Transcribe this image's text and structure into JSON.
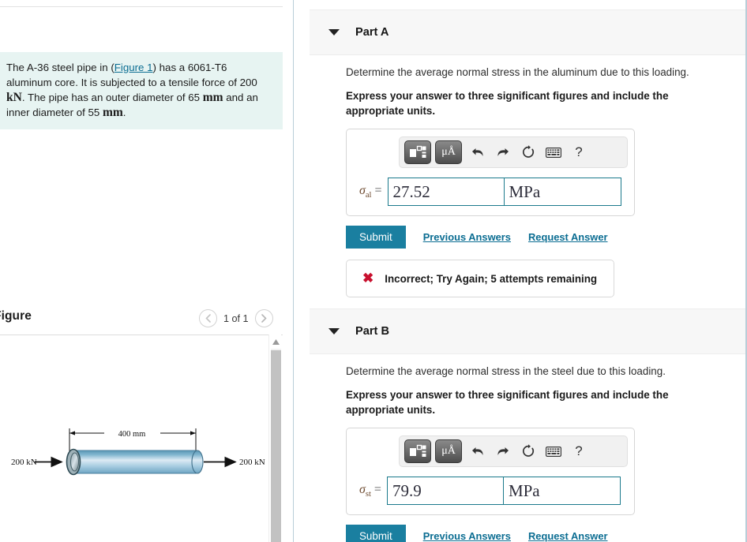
{
  "problem": {
    "text_before_link": "The A-36 steel pipe in (",
    "figure_link": "Figure 1",
    "text_after_link": ") has a 6061-T6 aluminum core. It is subjected to a tensile force of 200 ",
    "unit_force": "kN",
    "text_2": ". The pipe has an outer diameter of 65 ",
    "unit_mm_1": "mm",
    "text_3": " and an inner diameter of 55 ",
    "unit_mm_2": "mm",
    "text_4": "."
  },
  "figure": {
    "title": "Figure",
    "prev_icon": "chevron-left-icon",
    "next_icon": "chevron-right-icon",
    "counter": "1 of 1",
    "scroll_up_icon": "scroll-up-arrow-icon",
    "diagram": {
      "dimension_label": "400 mm",
      "force_left": "200 kN",
      "force_right": "200 kN"
    }
  },
  "parts": [
    {
      "caret_icon": "caret-down-icon",
      "title": "Part A",
      "prompt": "Determine the average normal stress in the aluminum due to this loading.",
      "instruction": "Express your answer to three significant figures and include the appropriate units.",
      "toolbar": {
        "template_icon": "math-template-icon",
        "units_label": "μÅ",
        "undo_icon": "undo-icon",
        "redo_icon": "redo-icon",
        "reset_icon": "reset-icon",
        "keyboard_icon": "keyboard-icon",
        "help_label": "?"
      },
      "symbol": "σ",
      "subscript": "al",
      "equals": "=",
      "value": "27.52",
      "unit": "MPa",
      "submit_label": "Submit",
      "previous_answers_label": "Previous Answers",
      "request_answer_label": "Request Answer",
      "feedback": {
        "icon": "incorrect-x-icon",
        "text": "Incorrect; Try Again; 5 attempts remaining"
      }
    },
    {
      "caret_icon": "caret-down-icon",
      "title": "Part B",
      "prompt": "Determine the average normal stress in the steel due to this loading.",
      "instruction": "Express your answer to three significant figures and include the appropriate units.",
      "toolbar": {
        "template_icon": "math-template-icon",
        "units_label": "μÅ",
        "undo_icon": "undo-icon",
        "redo_icon": "redo-icon",
        "reset_icon": "reset-icon",
        "keyboard_icon": "keyboard-icon",
        "help_label": "?"
      },
      "symbol": "σ",
      "subscript": "st",
      "equals": "=",
      "value": "79.9",
      "unit": "MPa",
      "submit_label": "Submit",
      "previous_answers_label": "Previous Answers",
      "request_answer_label": "Request Answer",
      "feedback": null
    }
  ],
  "colors": {
    "accent_teal": "#1a7fa0",
    "link_blue": "#0b6d92",
    "problem_bg": "#e7f4f2",
    "error_red": "#c8102e",
    "top_bar": "#0d5d75"
  }
}
